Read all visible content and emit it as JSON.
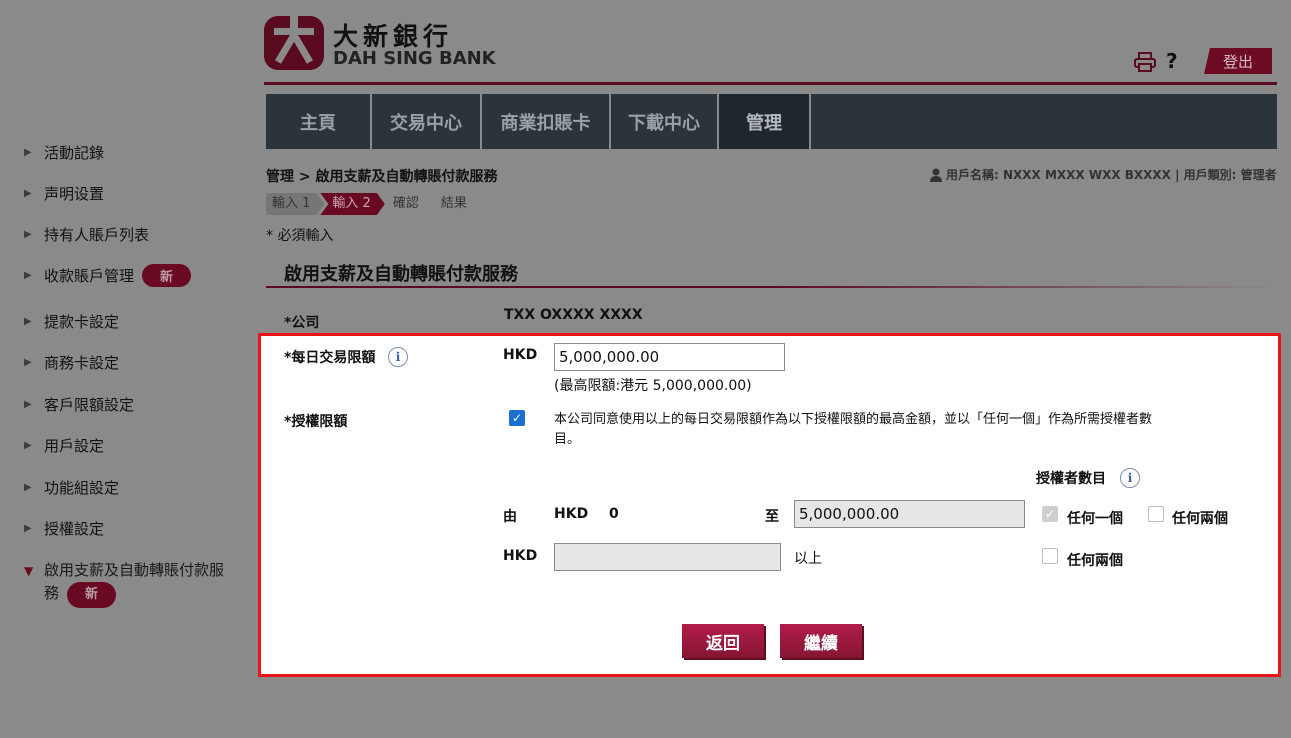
{
  "brand": {
    "name_cn": "大新銀行",
    "name_en": "DAH SING BANK"
  },
  "header": {
    "help": "?",
    "logout": "登出"
  },
  "nav": [
    {
      "label": "主頁",
      "width": 104
    },
    {
      "label": "交易中心",
      "width": 108
    },
    {
      "label": "商業扣賬卡",
      "width": 127
    },
    {
      "label": "下載中心",
      "width": 106
    },
    {
      "label": "管理",
      "width": 90,
      "active": true
    }
  ],
  "sidebar": {
    "items": [
      "活動記錄",
      "声明设置",
      "持有人賬戶列表",
      "收款賬戶管理",
      "提款卡設定",
      "商務卡設定",
      "客戶限額設定",
      "用戶設定",
      "功能組設定",
      "授權設定"
    ],
    "expanded_line1": "啟用支薪及自動轉賬付款服",
    "expanded_line2": "務",
    "badge": "新"
  },
  "breadcrumb": "管理 > 啟用支薪及自動轉賬付款服務",
  "user_info": "用戶名稱: NXXX MXXX WXX BXXXX | 用戶類別: 管理者",
  "steps": [
    "輸入 1",
    "輸入 2",
    "確認",
    "結果"
  ],
  "required_note": "* 必須輸入",
  "section_title": "啟用支薪及自動轉賬付款服務",
  "form": {
    "company_label": "*公司",
    "company_value": "TXX OXXXX XXXX",
    "daily_limit_label": "*每日交易限額",
    "currency": "HKD",
    "daily_limit_value": "5,000,000.00",
    "max_limit_note": "(最高限額:港元 5,000,000.00)",
    "auth_limit_label": "*授權限額",
    "agree_text_line1": "本公司同意使用以上的每日交易限額作為以下授權限額的最高金額，並以「任何一個」作為所需授權者數",
    "agree_text_line2": "目。",
    "approvers_label": "授權者數目",
    "from_label": "由",
    "from_value": "0",
    "to_label": "至",
    "to_value": "5,000,000.00",
    "above_label": "以上",
    "any_one": "任何一個",
    "any_two": "任何兩個"
  },
  "buttons": {
    "back": "返回",
    "continue": "繼續"
  },
  "colors": {
    "brand": "#6a0a22",
    "highlight": "#e8141a",
    "nav_bg": "#2c343b"
  }
}
